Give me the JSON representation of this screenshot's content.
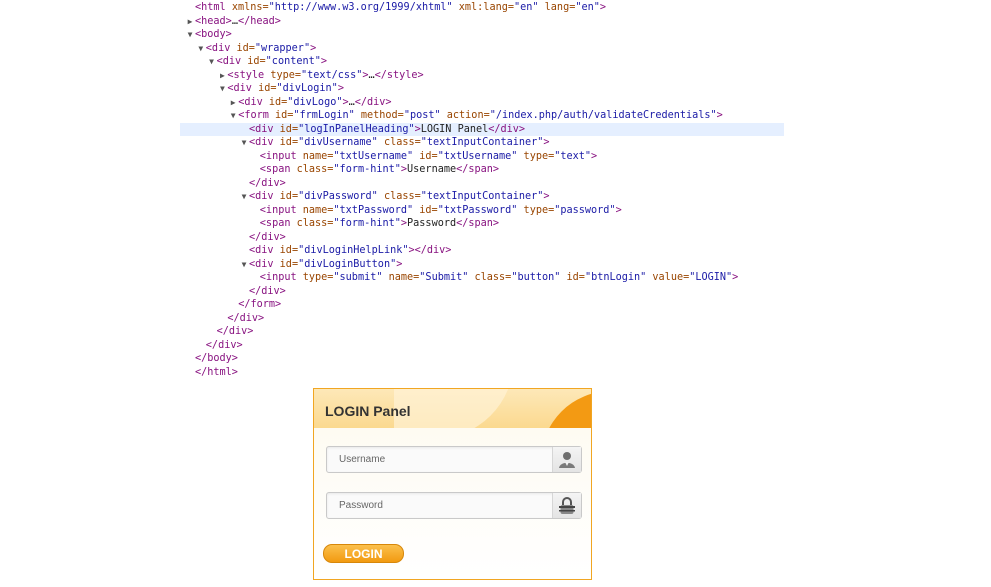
{
  "devtools": {
    "lines": [
      {
        "indent": 0,
        "arrow": "",
        "highlight": false,
        "parts": [
          {
            "c": "tg",
            "t": "<html "
          },
          {
            "c": "an",
            "t": "xmlns="
          },
          {
            "c": "av",
            "t": "\"http://www.w3.org/1999/xhtml\""
          },
          {
            "c": "an",
            "t": " xml:lang="
          },
          {
            "c": "av",
            "t": "\"en\""
          },
          {
            "c": "an",
            "t": " lang="
          },
          {
            "c": "av",
            "t": "\"en\""
          },
          {
            "c": "tg",
            "t": ">"
          }
        ]
      },
      {
        "indent": 0,
        "arrow": "▶",
        "highlight": false,
        "parts": [
          {
            "c": "tg",
            "t": "<head>"
          },
          {
            "c": "tx",
            "t": "…"
          },
          {
            "c": "tg",
            "t": "</head>"
          }
        ]
      },
      {
        "indent": 0,
        "arrow": "▼",
        "highlight": false,
        "parts": [
          {
            "c": "tg",
            "t": "<body>"
          }
        ]
      },
      {
        "indent": 1,
        "arrow": "▼",
        "highlight": false,
        "parts": [
          {
            "c": "tg",
            "t": "<div "
          },
          {
            "c": "an",
            "t": "id="
          },
          {
            "c": "av",
            "t": "\"wrapper\""
          },
          {
            "c": "tg",
            "t": ">"
          }
        ]
      },
      {
        "indent": 2,
        "arrow": "▼",
        "highlight": false,
        "parts": [
          {
            "c": "tg",
            "t": "<div "
          },
          {
            "c": "an",
            "t": "id="
          },
          {
            "c": "av",
            "t": "\"content\""
          },
          {
            "c": "tg",
            "t": ">"
          }
        ]
      },
      {
        "indent": 3,
        "arrow": "▶",
        "highlight": false,
        "parts": [
          {
            "c": "tg",
            "t": "<style "
          },
          {
            "c": "an",
            "t": "type="
          },
          {
            "c": "av",
            "t": "\"text/css\""
          },
          {
            "c": "tg",
            "t": ">"
          },
          {
            "c": "tx",
            "t": "…"
          },
          {
            "c": "tg",
            "t": "</style>"
          }
        ]
      },
      {
        "indent": 3,
        "arrow": "▼",
        "highlight": false,
        "parts": [
          {
            "c": "tg",
            "t": "<div "
          },
          {
            "c": "an",
            "t": "id="
          },
          {
            "c": "av",
            "t": "\"divLogin\""
          },
          {
            "c": "tg",
            "t": ">"
          }
        ]
      },
      {
        "indent": 4,
        "arrow": "▶",
        "highlight": false,
        "parts": [
          {
            "c": "tg",
            "t": "<div "
          },
          {
            "c": "an",
            "t": "id="
          },
          {
            "c": "av",
            "t": "\"divLogo\""
          },
          {
            "c": "tg",
            "t": ">"
          },
          {
            "c": "tx",
            "t": "…"
          },
          {
            "c": "tg",
            "t": "</div>"
          }
        ]
      },
      {
        "indent": 4,
        "arrow": "▼",
        "highlight": false,
        "parts": [
          {
            "c": "tg",
            "t": "<form "
          },
          {
            "c": "an",
            "t": "id="
          },
          {
            "c": "av",
            "t": "\"frmLogin\""
          },
          {
            "c": "an",
            "t": " method="
          },
          {
            "c": "av",
            "t": "\"post\""
          },
          {
            "c": "an",
            "t": " action="
          },
          {
            "c": "av",
            "t": "\"/index.php/auth/validateCredentials\""
          },
          {
            "c": "tg",
            "t": ">"
          }
        ]
      },
      {
        "indent": 5,
        "arrow": "",
        "highlight": true,
        "parts": [
          {
            "c": "tg",
            "t": "<div "
          },
          {
            "c": "an",
            "t": "id="
          },
          {
            "c": "av",
            "t": "\"logInPanelHeading\""
          },
          {
            "c": "tg",
            "t": ">"
          },
          {
            "c": "tx",
            "t": "LOGIN Panel"
          },
          {
            "c": "tg",
            "t": "</div>"
          }
        ]
      },
      {
        "indent": 5,
        "arrow": "▼",
        "highlight": false,
        "parts": [
          {
            "c": "tg",
            "t": "<div "
          },
          {
            "c": "an",
            "t": "id="
          },
          {
            "c": "av",
            "t": "\"divUsername\""
          },
          {
            "c": "an",
            "t": " class="
          },
          {
            "c": "av",
            "t": "\"textInputContainer\""
          },
          {
            "c": "tg",
            "t": ">"
          }
        ]
      },
      {
        "indent": 6,
        "arrow": "",
        "highlight": false,
        "parts": [
          {
            "c": "tg",
            "t": "<input "
          },
          {
            "c": "an",
            "t": "name="
          },
          {
            "c": "av",
            "t": "\"txtUsername\""
          },
          {
            "c": "an",
            "t": " id="
          },
          {
            "c": "av",
            "t": "\"txtUsername\""
          },
          {
            "c": "an",
            "t": " type="
          },
          {
            "c": "av",
            "t": "\"text\""
          },
          {
            "c": "tg",
            "t": ">"
          }
        ]
      },
      {
        "indent": 6,
        "arrow": "",
        "highlight": false,
        "parts": [
          {
            "c": "tg",
            "t": "<span "
          },
          {
            "c": "an",
            "t": "class="
          },
          {
            "c": "av",
            "t": "\"form-hint\""
          },
          {
            "c": "tg",
            "t": ">"
          },
          {
            "c": "tx",
            "t": "Username"
          },
          {
            "c": "tg",
            "t": "</span>"
          }
        ]
      },
      {
        "indent": 5,
        "arrow": "",
        "highlight": false,
        "parts": [
          {
            "c": "tg",
            "t": "</div>"
          }
        ]
      },
      {
        "indent": 5,
        "arrow": "▼",
        "highlight": false,
        "parts": [
          {
            "c": "tg",
            "t": "<div "
          },
          {
            "c": "an",
            "t": "id="
          },
          {
            "c": "av",
            "t": "\"divPassword\""
          },
          {
            "c": "an",
            "t": " class="
          },
          {
            "c": "av",
            "t": "\"textInputContainer\""
          },
          {
            "c": "tg",
            "t": ">"
          }
        ]
      },
      {
        "indent": 6,
        "arrow": "",
        "highlight": false,
        "parts": [
          {
            "c": "tg",
            "t": "<input "
          },
          {
            "c": "an",
            "t": "name="
          },
          {
            "c": "av",
            "t": "\"txtPassword\""
          },
          {
            "c": "an",
            "t": " id="
          },
          {
            "c": "av",
            "t": "\"txtPassword\""
          },
          {
            "c": "an",
            "t": " type="
          },
          {
            "c": "av",
            "t": "\"password\""
          },
          {
            "c": "tg",
            "t": ">"
          }
        ]
      },
      {
        "indent": 6,
        "arrow": "",
        "highlight": false,
        "parts": [
          {
            "c": "tg",
            "t": "<span "
          },
          {
            "c": "an",
            "t": "class="
          },
          {
            "c": "av",
            "t": "\"form-hint\""
          },
          {
            "c": "tg",
            "t": ">"
          },
          {
            "c": "tx",
            "t": "Password"
          },
          {
            "c": "tg",
            "t": "</span>"
          }
        ]
      },
      {
        "indent": 5,
        "arrow": "",
        "highlight": false,
        "parts": [
          {
            "c": "tg",
            "t": "</div>"
          }
        ]
      },
      {
        "indent": 5,
        "arrow": "",
        "highlight": false,
        "parts": [
          {
            "c": "tg",
            "t": "<div "
          },
          {
            "c": "an",
            "t": "id="
          },
          {
            "c": "av",
            "t": "\"divLoginHelpLink\""
          },
          {
            "c": "tg",
            "t": "></div>"
          }
        ]
      },
      {
        "indent": 5,
        "arrow": "▼",
        "highlight": false,
        "parts": [
          {
            "c": "tg",
            "t": "<div "
          },
          {
            "c": "an",
            "t": "id="
          },
          {
            "c": "av",
            "t": "\"divLoginButton\""
          },
          {
            "c": "tg",
            "t": ">"
          }
        ]
      },
      {
        "indent": 6,
        "arrow": "",
        "highlight": false,
        "parts": [
          {
            "c": "tg",
            "t": "<input "
          },
          {
            "c": "an",
            "t": "type="
          },
          {
            "c": "av",
            "t": "\"submit\""
          },
          {
            "c": "an",
            "t": " name="
          },
          {
            "c": "av",
            "t": "\"Submit\""
          },
          {
            "c": "an",
            "t": " class="
          },
          {
            "c": "av",
            "t": "\"button\""
          },
          {
            "c": "an",
            "t": " id="
          },
          {
            "c": "av",
            "t": "\"btnLogin\""
          },
          {
            "c": "an",
            "t": " value="
          },
          {
            "c": "av",
            "t": "\"LOGIN\""
          },
          {
            "c": "tg",
            "t": ">"
          }
        ]
      },
      {
        "indent": 5,
        "arrow": "",
        "highlight": false,
        "parts": [
          {
            "c": "tg",
            "t": "</div>"
          }
        ]
      },
      {
        "indent": 4,
        "arrow": "",
        "highlight": false,
        "parts": [
          {
            "c": "tg",
            "t": "</form>"
          }
        ]
      },
      {
        "indent": 3,
        "arrow": "",
        "highlight": false,
        "parts": [
          {
            "c": "tg",
            "t": "</div>"
          }
        ]
      },
      {
        "indent": 2,
        "arrow": "",
        "highlight": false,
        "parts": [
          {
            "c": "tg",
            "t": "</div>"
          }
        ]
      },
      {
        "indent": 1,
        "arrow": "",
        "highlight": false,
        "parts": [
          {
            "c": "tg",
            "t": "</div>"
          }
        ]
      },
      {
        "indent": 0,
        "arrow": "",
        "highlight": false,
        "parts": [
          {
            "c": "tg",
            "t": "</body>"
          }
        ]
      },
      {
        "indent": 0,
        "arrow": "",
        "highlight": false,
        "parts": [
          {
            "c": "tg",
            "t": "</html>"
          }
        ]
      }
    ]
  },
  "login": {
    "title": "LOGIN Panel",
    "username_placeholder": "Username",
    "password_placeholder": "Password",
    "username_icon": "user-icon",
    "password_icon": "lock-icon",
    "button_label": "LOGIN",
    "accent_color": "#f39a13",
    "border_color": "#f1a622"
  }
}
